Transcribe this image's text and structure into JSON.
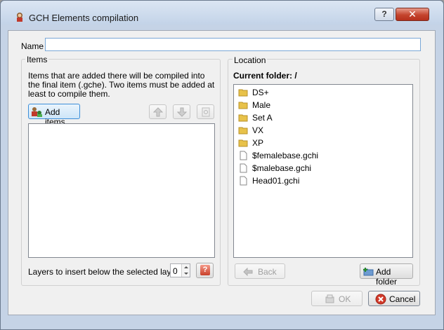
{
  "window": {
    "title": "GCH Elements compilation",
    "help_label": "?",
    "close_label": "✕"
  },
  "name_field": {
    "label": "Name",
    "value": ""
  },
  "items_panel": {
    "title": "Items",
    "description": "Items that are added there will be compiled into the final item (.gche). Two items must be added at least to compile them.",
    "add_items_label": "Add items",
    "items": [],
    "layers_label": "Layers to insert below the selected layer",
    "layers_value": "0",
    "help_label": "?"
  },
  "location_panel": {
    "title": "Location",
    "current_folder_label": "Current folder:",
    "current_folder_path": "/",
    "entries": [
      {
        "name": "DS+",
        "type": "folder"
      },
      {
        "name": "Male",
        "type": "folder"
      },
      {
        "name": "Set A",
        "type": "folder"
      },
      {
        "name": "VX",
        "type": "folder"
      },
      {
        "name": "XP",
        "type": "folder"
      },
      {
        "name": "$femalebase.gchi",
        "type": "file"
      },
      {
        "name": "$malebase.gchi",
        "type": "file"
      },
      {
        "name": "Head01.gchi",
        "type": "file"
      }
    ],
    "back_label": "Back",
    "add_folder_label": "Add folder"
  },
  "footer": {
    "ok_label": "OK",
    "cancel_label": "Cancel"
  },
  "colors": {
    "window_frame": "#c5d3e6",
    "dialog_bg": "#f0f0f0",
    "close_button": "#c4442d",
    "focus_border": "#3c8ed8",
    "folder_icon": "#e8c24a"
  }
}
